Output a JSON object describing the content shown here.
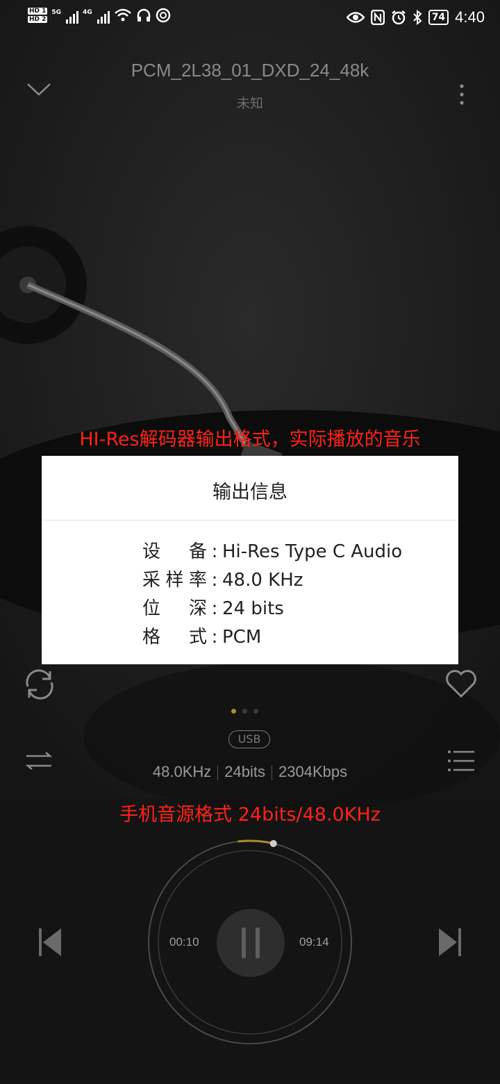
{
  "status_bar": {
    "hd1": "HD 1",
    "hd2": "HD 2",
    "net1": "5G",
    "net2": "4G",
    "battery": "74",
    "time": "4:40"
  },
  "player": {
    "title": "PCM_2L38_01_DXD_24_48k",
    "artist": "未知",
    "output_tag": "USB",
    "sample_rate": "48.0KHz",
    "bit_depth": "24bits",
    "bitrate": "2304Kbps",
    "elapsed": "00:10",
    "duration": "09:14",
    "progress_fraction": 0.018
  },
  "annotations": {
    "top": "HI-Res解码器输出格式，实际播放的音乐",
    "bottom": "手机音源格式 24bits/48.0KHz"
  },
  "dialog": {
    "title": "输出信息",
    "rows": [
      {
        "label": "设备",
        "value": "Hi-Res Type C Audio"
      },
      {
        "label": "采样率",
        "value": "48.0 KHz"
      },
      {
        "label": "位深",
        "value": "24 bits"
      },
      {
        "label": "格式",
        "value": "PCM"
      }
    ]
  },
  "colors": {
    "background": "#161616",
    "annotation": "#ff2218",
    "accent": "#b08a2c"
  },
  "icons": [
    "collapse-chevron-icon",
    "more-vertical-icon",
    "repeat-icon",
    "heart-icon",
    "shuffle-icon",
    "playlist-icon",
    "previous-icon",
    "pause-icon",
    "next-icon"
  ]
}
